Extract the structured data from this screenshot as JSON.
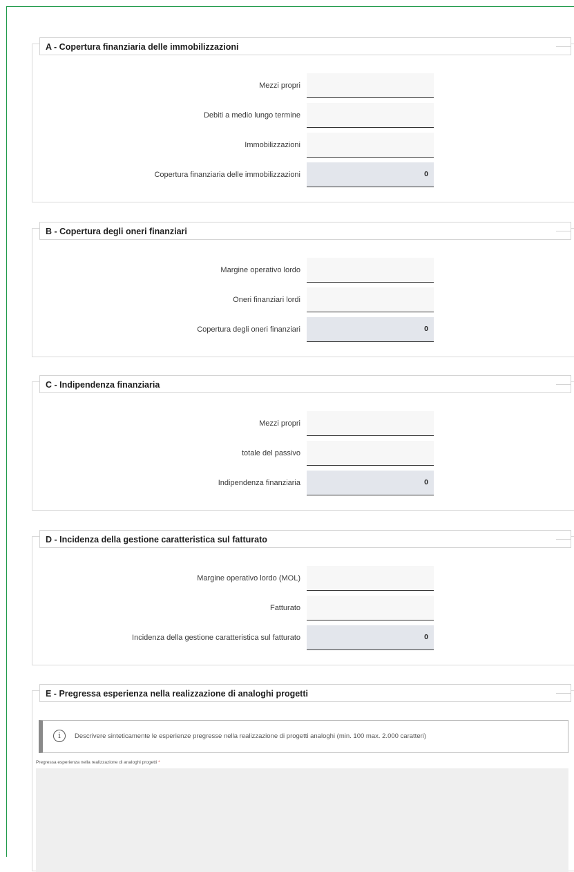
{
  "sections": [
    {
      "title": "A - Copertura finanziaria delle immobilizzazioni",
      "rows": [
        {
          "label": "Mezzi propri",
          "value": ""
        },
        {
          "label": "Debiti a medio lungo termine",
          "value": ""
        },
        {
          "label": "Immobilizzazioni",
          "value": ""
        },
        {
          "label": "Copertura finanziaria delle immobilizzazioni",
          "value": "0"
        }
      ]
    },
    {
      "title": "B - Copertura degli oneri finanziari",
      "rows": [
        {
          "label": "Margine operativo lordo",
          "value": ""
        },
        {
          "label": "Oneri finanziari lordi",
          "value": ""
        },
        {
          "label": "Copertura degli oneri finanziari",
          "value": "0"
        }
      ]
    },
    {
      "title": "C - Indipendenza finanziaria",
      "rows": [
        {
          "label": "Mezzi propri",
          "value": ""
        },
        {
          "label": "totale del passivo",
          "value": ""
        },
        {
          "label": "Indipendenza finanziaria",
          "value": "0"
        }
      ]
    },
    {
      "title": "D - Incidenza della gestione caratteristica sul fatturato",
      "rows": [
        {
          "label": "Margine operativo lordo (MOL)",
          "value": ""
        },
        {
          "label": "Fatturato",
          "value": ""
        },
        {
          "label": "Incidenza della gestione caratteristica sul fatturato",
          "value": "0"
        }
      ]
    },
    {
      "title": "E - Pregressa esperienza nella realizzazione di analoghi progetti",
      "info_icon": "info-icon",
      "info_text": "Descrivere sinteticamente le esperienze pregresse nella realizzazione di progetti analoghi (min. 100 max. 2.000 caratteri)",
      "field_label": "Pregressa esperienza nella realizzazione di analoghi progetti",
      "required_mark": "*",
      "field_value": ""
    }
  ],
  "colors": {
    "frame_border": "#1f9a4a",
    "calculated_field_bg": "#e3e6ec",
    "input_field_bg": "#f7f7f7",
    "required_mark": "#d9534f"
  }
}
